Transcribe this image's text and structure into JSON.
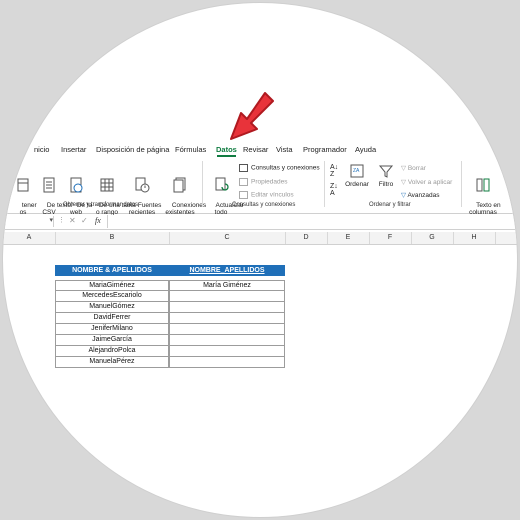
{
  "ribbon_tabs": [
    "nicio",
    "Insertar",
    "Disposición de página",
    "Fórmulas",
    "Datos",
    "Revisar",
    "Vista",
    "Programador",
    "Ayuda"
  ],
  "buttons": {
    "obtener": "tener\nos",
    "texto_csv": "De texto/\nCSV",
    "web": "De la\nweb",
    "tabla": "De una tabla\no rango",
    "recientes": "Fuentes\nrecientes",
    "existentes": "Conexiones\nexistentes",
    "actualizar": "Actualizar\ntodo",
    "consultas": "Consultas y conexiones",
    "propiedades": "Propiedades",
    "vinculos": "Editar vínculos",
    "ordenar": "Ordenar",
    "filtro": "Filtro",
    "borrar": "Borrar",
    "volver": "Volver a aplicar",
    "avanzadas": "Avanzadas",
    "texto_columnas": "Texto en\ncolumnas"
  },
  "groups": {
    "obtener": "Obtener y transformar datos",
    "consultas": "Consultas y conexiones",
    "ordenar": "Ordenar y filtrar"
  },
  "formula_bar": {
    "fx": "fx"
  },
  "columns": [
    "A",
    "B",
    "C",
    "D",
    "E",
    "F",
    "G",
    "H"
  ],
  "table": {
    "headers": [
      "NOMBRE & APELLIDOS",
      "NOMBRE_APELLIDOS"
    ],
    "rows": [
      [
        "MariaGiménez",
        "María Giménez"
      ],
      [
        "MercedesEscariolo",
        ""
      ],
      [
        "ManuelGómez",
        ""
      ],
      [
        "DavidFerrer",
        ""
      ],
      [
        "JeniferMilano",
        ""
      ],
      [
        "JaimeGarcía",
        ""
      ],
      [
        "AlejandroPolca",
        ""
      ],
      [
        "ManuelaPérez",
        ""
      ]
    ]
  },
  "colors": {
    "accent": "#107c41",
    "header_fill": "#1f6fb8",
    "arrow": "#e8333a"
  }
}
